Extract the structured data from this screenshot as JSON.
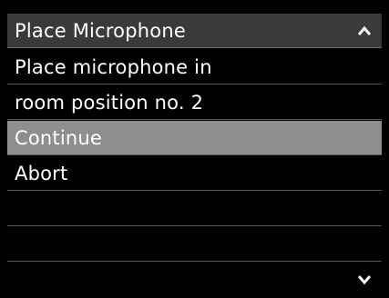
{
  "header": {
    "title": "Place Microphone",
    "up_icon": "chevron-up-icon"
  },
  "message": {
    "line1": "Place microphone in",
    "line2": "room position no. 2"
  },
  "menu": {
    "items": [
      {
        "label": "Continue",
        "selected": true
      },
      {
        "label": "Abort",
        "selected": false
      }
    ]
  },
  "footer": {
    "down_icon": "chevron-down-icon"
  }
}
